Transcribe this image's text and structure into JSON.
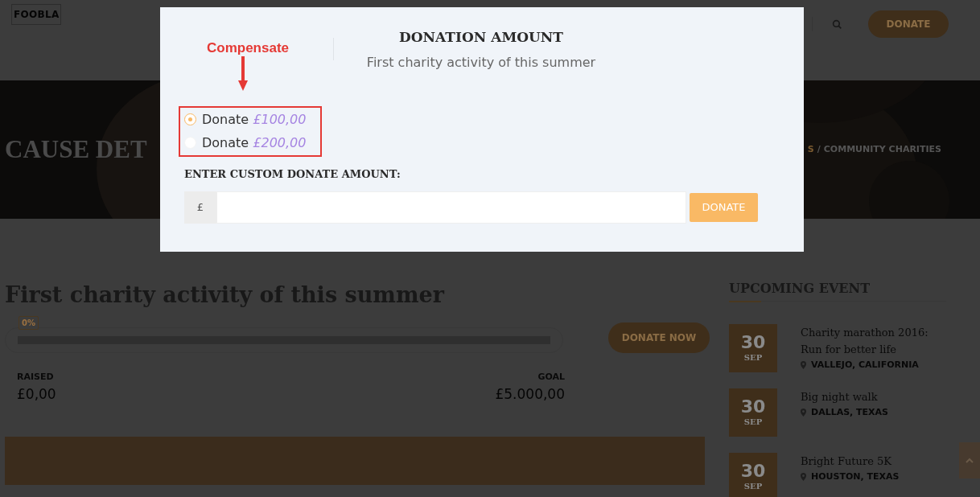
{
  "header": {
    "logo": "FOOBLA",
    "donate_button": "DONATE"
  },
  "hero": {
    "title": "CAUSE DET",
    "breadcrumb": [
      {
        "label": "S",
        "current": false
      },
      {
        "label": "COMMUNITY CHARITIES",
        "current": true
      }
    ],
    "separator": "/"
  },
  "cause": {
    "title": "First charity activity of this summer",
    "progress": {
      "badge": "0%",
      "level": 0
    },
    "donate_button": "DONATE NOW",
    "raised": {
      "label": "RAISED",
      "value": "£0,00"
    },
    "goal": {
      "label": "GOAL",
      "value": "£5.000,00"
    }
  },
  "sidebar": {
    "title": "UPCOMING EVENT",
    "events": [
      {
        "day": "30",
        "month": "SEP",
        "title": "Charity marathon 2016: Run for better life",
        "location": "VALLEJO, CALIFORNIA"
      },
      {
        "day": "30",
        "month": "SEP",
        "title": "Big night walk",
        "location": "DALLAS, TEXAS"
      },
      {
        "day": "30",
        "month": "SEP",
        "title": "Bright Future 5K",
        "location": "HOUSTON, TEXAS"
      }
    ]
  },
  "modal": {
    "title": "DONATION AMOUNT",
    "subtitle": "First charity activity of this summer",
    "options": [
      {
        "label": "Donate",
        "amount": "£100,00",
        "selected": true
      },
      {
        "label": "Donate",
        "amount": "£200,00",
        "selected": false
      }
    ],
    "custom_label": "ENTER CUSTOM DONATE AMOUNT:",
    "currency": "£",
    "submit": "DONATE"
  },
  "annotation": {
    "text": "Compensate"
  }
}
